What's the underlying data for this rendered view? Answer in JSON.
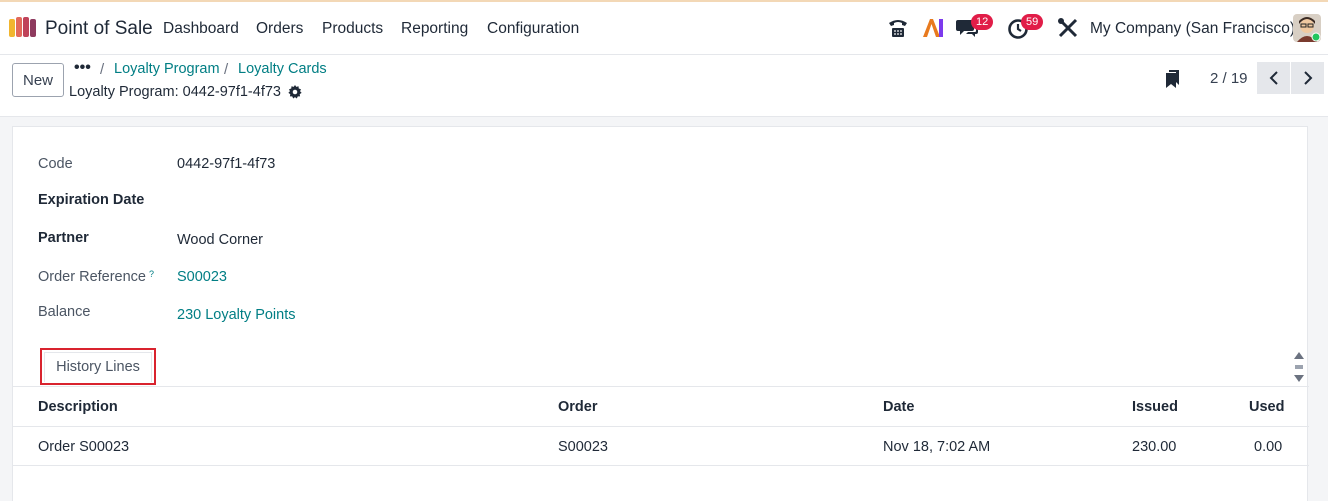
{
  "app": {
    "name": "Point of Sale",
    "menu": [
      "Dashboard",
      "Orders",
      "Products",
      "Reporting",
      "Configuration"
    ],
    "company": "My Company (San Francisco)",
    "badges": {
      "messages": "12",
      "activities": "59"
    }
  },
  "control": {
    "new_label": "New",
    "more": "•••",
    "breadcrumb": [
      "Loyalty Program",
      "Loyalty Cards"
    ],
    "separator": "/",
    "record_title": "Loyalty Program: 0442-97f1-4f73",
    "pager": "2 / 19"
  },
  "form": {
    "code_label": "Code",
    "code_value": "0442-97f1-4f73",
    "expiration_label": "Expiration Date",
    "partner_label": "Partner",
    "partner_value": "Wood Corner",
    "order_ref_label": "Order Reference",
    "order_ref_help": "?",
    "order_ref_value": "S00023",
    "balance_label": "Balance",
    "balance_value": "230 Loyalty Points"
  },
  "tabs": {
    "history": "History Lines"
  },
  "table": {
    "columns": [
      "Description",
      "Order",
      "Date",
      "Issued",
      "Used"
    ],
    "rows": [
      {
        "description": "Order S00023",
        "order": "S00023",
        "date": "Nov 18, 7:02 AM",
        "issued": "230.00",
        "used": "0.00"
      }
    ]
  },
  "colors": {
    "accent": "#017e84",
    "highlight": "#d9232e",
    "badge": "#e11d48"
  }
}
